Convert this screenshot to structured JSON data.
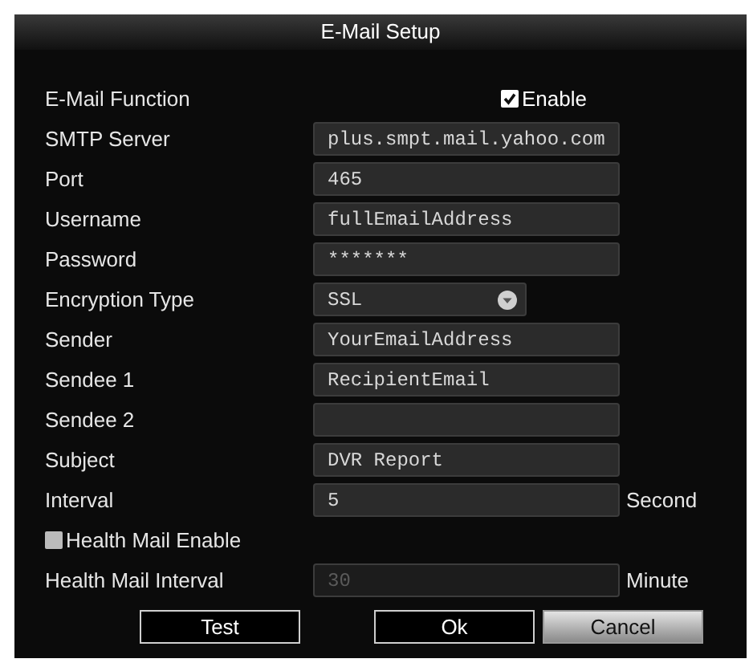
{
  "window": {
    "title": "E-Mail Setup"
  },
  "rows": [
    {
      "kind": "checkbox",
      "label": "E-Mail Function",
      "option": "Enable",
      "checked": true
    },
    {
      "kind": "field",
      "label": "SMTP Server",
      "value": "plus.smpt.mail.yahoo.com",
      "disabled": false
    },
    {
      "kind": "field",
      "label": "Port",
      "value": "465",
      "disabled": false
    },
    {
      "kind": "field",
      "label": "Username",
      "value": "fullEmailAddress",
      "disabled": false
    },
    {
      "kind": "field",
      "label": "Password",
      "value": "*******",
      "disabled": false
    },
    {
      "kind": "dropdown",
      "label": "Encryption Type",
      "value": "SSL"
    },
    {
      "kind": "field",
      "label": "Sender",
      "value": "YourEmailAddress",
      "disabled": false
    },
    {
      "kind": "field",
      "label": "Sendee 1",
      "value": "RecipientEmail",
      "disabled": false
    },
    {
      "kind": "field",
      "label": "Sendee 2",
      "disabled": false
    },
    {
      "kind": "field",
      "label": "Subject",
      "value": "DVR Report",
      "disabled": false
    },
    {
      "kind": "field",
      "label": "Interval",
      "value": "5",
      "unit": "Second",
      "disabled": false
    },
    {
      "kind": "toggle",
      "label": "Health Mail Enable",
      "checked": false
    },
    {
      "kind": "field",
      "label": "Health Mail Interval",
      "value": "30",
      "unit": "Minute",
      "disabled": true
    }
  ],
  "buttons": [
    {
      "label": "Test",
      "selected": false
    },
    {
      "label": "Ok",
      "selected": false
    },
    {
      "label": "Cancel",
      "selected": true
    }
  ]
}
